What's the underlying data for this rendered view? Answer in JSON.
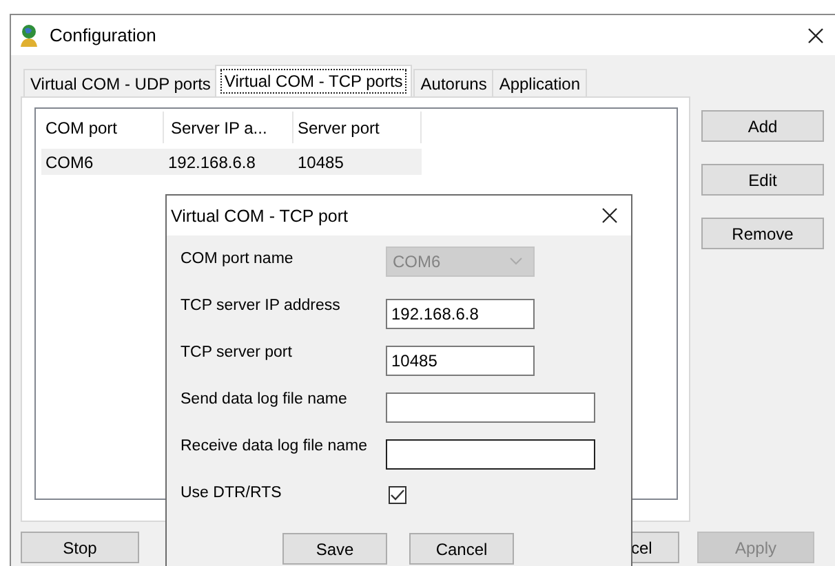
{
  "window": {
    "title": "Configuration"
  },
  "tabs": [
    {
      "label": "Virtual COM - UDP ports",
      "selected": false
    },
    {
      "label": "Virtual COM - TCP ports",
      "selected": true
    },
    {
      "label": "Autoruns",
      "selected": false
    },
    {
      "label": "Application",
      "selected": false
    }
  ],
  "table": {
    "columns": [
      "COM port",
      "Server IP a...",
      "Server port"
    ],
    "rows": [
      {
        "cells": [
          "COM6",
          "192.168.6.8",
          "10485"
        ],
        "selected": true
      }
    ]
  },
  "side_buttons": [
    "Add",
    "Edit",
    "Remove"
  ],
  "bottom_buttons": [
    {
      "label": "Stop",
      "disabled": false
    },
    {
      "label": "cel",
      "disabled": false
    },
    {
      "label": "Apply",
      "disabled": true
    }
  ],
  "dialog": {
    "title": "Virtual COM - TCP port",
    "fields": [
      {
        "label": "COM port name",
        "kind": "combo",
        "value": "COM6",
        "disabled": true
      },
      {
        "label": "TCP server IP address",
        "kind": "text",
        "value": "192.168.6.8",
        "wide": false,
        "focused": false
      },
      {
        "label": "TCP server port",
        "kind": "text",
        "value": "10485",
        "wide": false,
        "focused": false
      },
      {
        "label": "Send data log file name",
        "kind": "text",
        "wide": true,
        "focused": false
      },
      {
        "label": "Receive data log file name",
        "kind": "text",
        "wide": true,
        "focused": true
      },
      {
        "label": "Use DTR/RTS",
        "kind": "checkbox",
        "checked": true
      }
    ],
    "buttons": [
      "Save",
      "Cancel"
    ]
  }
}
